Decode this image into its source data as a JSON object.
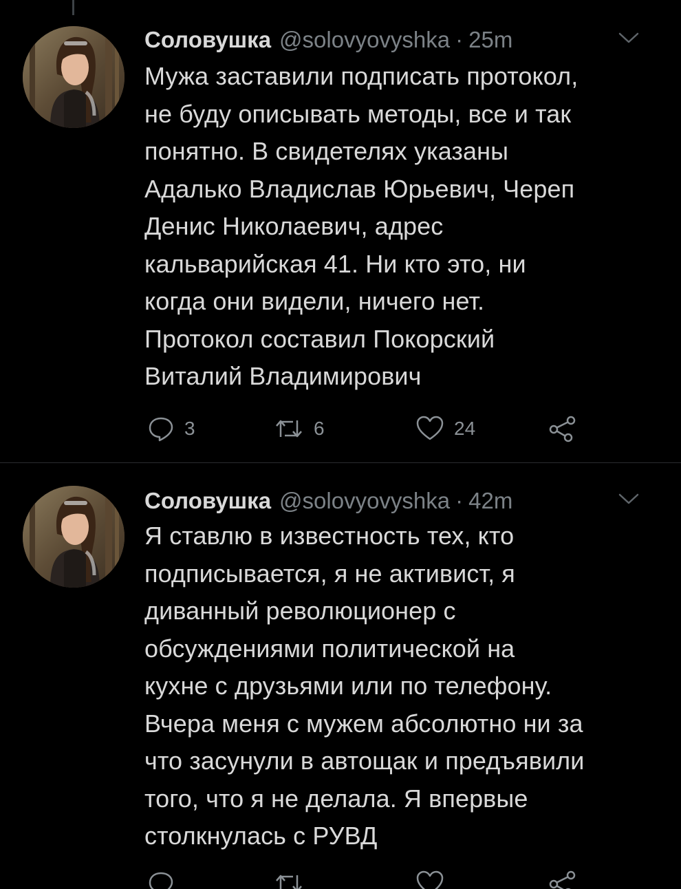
{
  "theme": {
    "background": "#000000",
    "text": "#d9d9d9",
    "muted": "#7c8287",
    "divider": "#2a2d30"
  },
  "tweets": [
    {
      "display_name": "Соловушка",
      "handle": "@solovyovyshka",
      "separator": "·",
      "time": "25m",
      "text": "Мужа заставили подписать протокол,\nне буду описывать методы, все и так\nпонятно. В свидетелях указаны\nАдалько Владислав Юрьевич, Череп\nДенис Николаевич, адрес\nкальварийская 41. Ни кто это, ни\nкогда они видели, ничего нет.\nПротокол составил Покорский\nВиталий Владимирович",
      "replies": "3",
      "retweets": "6",
      "likes": "24",
      "icons": [
        "reply-icon",
        "retweet-icon",
        "like-icon",
        "share-icon",
        "chevron-down-icon"
      ]
    },
    {
      "display_name": "Соловушка",
      "handle": "@solovyovyshka",
      "separator": "·",
      "time": "42m",
      "text": "Я ставлю в известность тех, кто\nподписывается, я не активист, я\nдиванный революционер с\nобсуждениями политической на\nкухне с друзьями или по телефону.\nВчера меня с мужем абсолютно ни за\nчто засунули в автощак и предъявили\nтого, что я не делала. Я впервые\nстолкнулась с РУВД",
      "icons": [
        "reply-icon",
        "retweet-icon",
        "like-icon",
        "share-icon",
        "chevron-down-icon"
      ]
    }
  ]
}
